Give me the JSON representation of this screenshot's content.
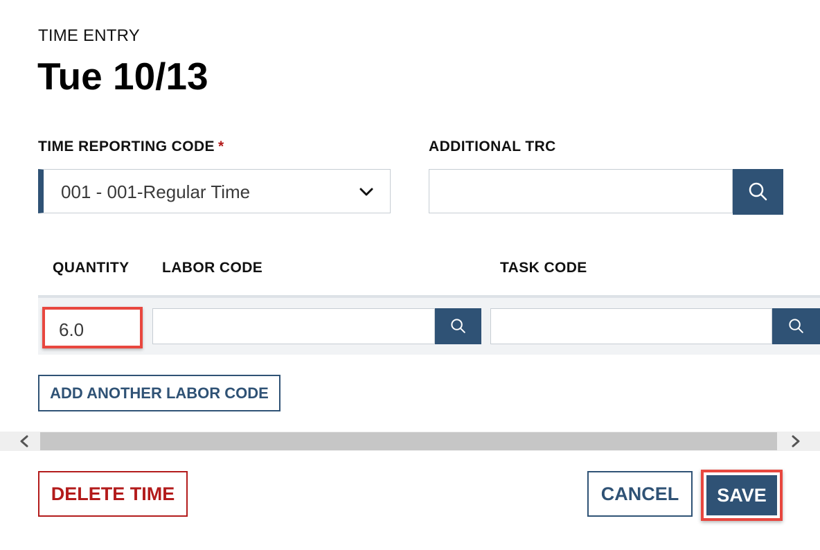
{
  "header": {
    "eyebrow": "TIME ENTRY",
    "title": "Tue 10/13"
  },
  "trc": {
    "label": "TIME REPORTING CODE",
    "required_mark": "*",
    "selected": "001 - 001-Regular Time"
  },
  "additional_trc": {
    "label": "ADDITIONAL TRC",
    "value": ""
  },
  "columns": {
    "quantity": "QUANTITY",
    "labor_code": "LABOR CODE",
    "task_code": "TASK CODE"
  },
  "row": {
    "quantity": "6.0",
    "labor_code": "",
    "task_code": ""
  },
  "add_labor_label": "ADD ANOTHER LABOR CODE",
  "footer": {
    "delete_label": "DELETE TIME",
    "cancel_label": "CANCEL",
    "save_label": "SAVE"
  },
  "colors": {
    "primary": "#2f5275",
    "danger": "#b31b1b",
    "highlight": "#e8473f"
  },
  "icons": {
    "search": "search-icon",
    "dropdown": "chevron-down-icon",
    "scroll_left": "chevron-left-icon",
    "scroll_right": "chevron-right-icon"
  }
}
